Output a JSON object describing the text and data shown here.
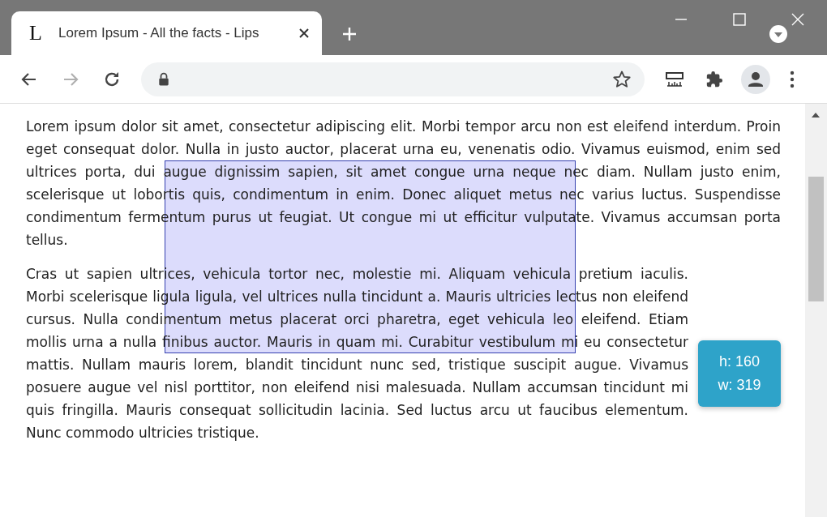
{
  "tab": {
    "favicon": "L",
    "title": "Lorem Ipsum - All the facts - Lips",
    "selected": true
  },
  "navigation": {
    "forward_disabled": true
  },
  "paragraphs": [
    "Lorem ipsum dolor sit amet, consectetur adipiscing elit. Morbi tempor arcu non est eleifend interdum. Proin eget consequat dolor. Nulla in justo auctor, placerat urna eu, venenatis odio. Vivamus euismod, enim sed ultrices porta, dui augue dignissim sapien, sit amet congue urna neque nec diam. Nullam justo enim, scelerisque ut lobortis quis, condimentum in enim. Donec aliquet metus nec varius luctus. Suspendisse condimentum fermentum purus ut feugiat. Ut congue mi ut efficitur vulputate. Vivamus accumsan porta tellus.",
    "Cras ut sapien ultrices, vehicula tortor nec, molestie mi. Aliquam vehicula pretium iaculis. Morbi scelerisque ligula ligula, vel ultrices nulla tincidunt a. Mauris ultricies lectus non eleifend cursus. Nulla condimentum metus placerat orci pharetra, eget vehicula leo eleifend. Etiam mollis urna a nulla finibus auctor. Mauris in quam mi. Curabitur vestibulum mi eu consectetur mattis. Nullam mauris lorem, blandit tincidunt nunc sed, tristique suscipit augue. Vivamus posuere augue vel nisl porttitor, non eleifend nisi malesuada. Nullam accumsan tincidunt mi quis fringilla. Mauris consequat sollicitudin lacinia. Sed luctus arcu ut faucibus elementum. Nunc commodo ultricies tristique."
  ],
  "selection_tooltip": {
    "height": "h: 160",
    "width": "w: 319"
  }
}
